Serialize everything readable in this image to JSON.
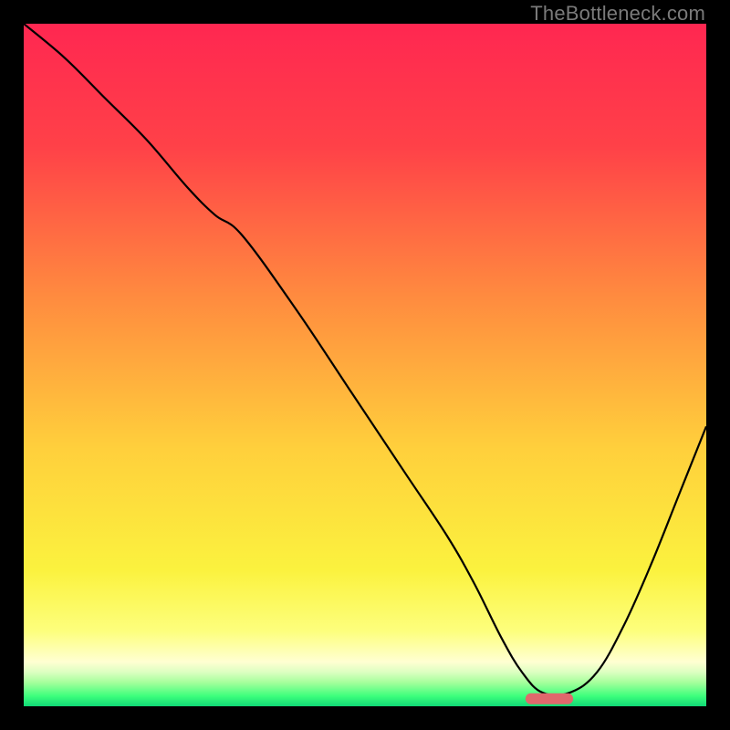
{
  "watermark": "TheBottleneck.com",
  "chart_data": {
    "type": "line",
    "title": "",
    "xlabel": "",
    "ylabel": "",
    "xlim": [
      0,
      100
    ],
    "ylim": [
      0,
      100
    ],
    "grid": false,
    "legend": "none",
    "background_gradient_stops": [
      {
        "pct": 0,
        "color": "#ff2751"
      },
      {
        "pct": 18,
        "color": "#ff4148"
      },
      {
        "pct": 40,
        "color": "#ff8b3f"
      },
      {
        "pct": 62,
        "color": "#ffcf3c"
      },
      {
        "pct": 80,
        "color": "#fbf23e"
      },
      {
        "pct": 89,
        "color": "#fdff7d"
      },
      {
        "pct": 93.5,
        "color": "#ffffd2"
      },
      {
        "pct": 95.0,
        "color": "#dcffc1"
      },
      {
        "pct": 96.5,
        "color": "#a6ff9c"
      },
      {
        "pct": 98.5,
        "color": "#3dff7c"
      },
      {
        "pct": 100,
        "color": "#10d876"
      }
    ],
    "series": [
      {
        "name": "bottleneck-curve",
        "color": "#000000",
        "x": [
          0,
          6,
          12,
          18,
          24,
          28,
          32,
          40,
          48,
          56,
          62,
          66,
          70,
          73,
          76,
          80,
          84,
          88,
          92,
          96,
          100
        ],
        "y": [
          100,
          95,
          89,
          83,
          76,
          72,
          69,
          58,
          46,
          34,
          25,
          18,
          10,
          5,
          2,
          2,
          5,
          12,
          21,
          31,
          41
        ]
      }
    ],
    "marker": {
      "name": "optimal-range-marker",
      "x_start": 73.5,
      "x_end": 80.5,
      "y": 1.1,
      "color": "#e0686c",
      "thickness_pct": 1.6
    }
  }
}
